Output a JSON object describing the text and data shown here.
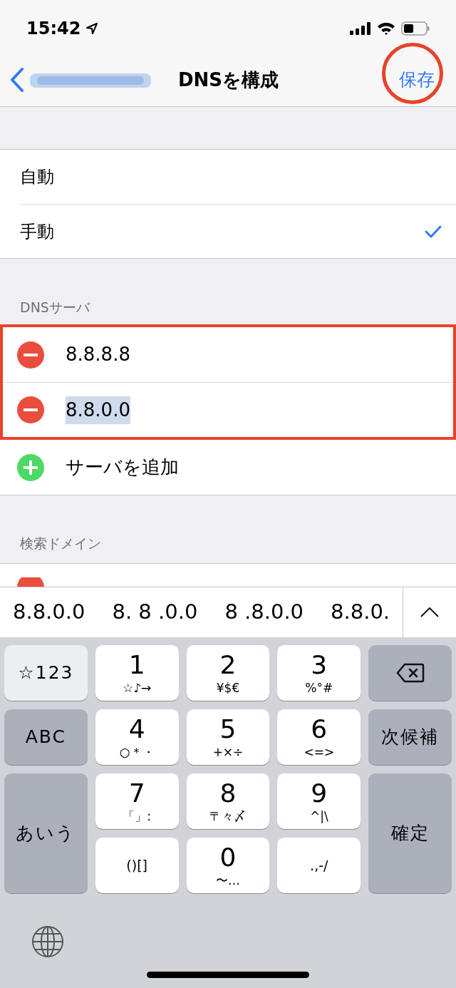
{
  "status_bar": {
    "time": "15:42"
  },
  "nav": {
    "title": "DNSを構成",
    "save": "保存"
  },
  "mode_options": [
    {
      "label": "自動",
      "selected": false
    },
    {
      "label": "手動",
      "selected": true
    }
  ],
  "dns_servers": {
    "header": "DNSサーバ",
    "servers": [
      {
        "value": "8.8.8.8",
        "selected": false
      },
      {
        "value": "8.8.0.0",
        "selected": true
      }
    ],
    "add_label": "サーバを追加"
  },
  "search_domains": {
    "header": "検索ドメイン"
  },
  "candidates": [
    "8.8.0.0",
    "8. 8 .0.0",
    "8 .8.0.0",
    "8.8.0."
  ],
  "keyboard": {
    "keys": [
      {
        "kind": "light",
        "main": "☆123"
      },
      {
        "kind": "digit",
        "main": "1",
        "sub": "☆♪→"
      },
      {
        "kind": "digit",
        "main": "2",
        "sub": "¥$€"
      },
      {
        "kind": "digit",
        "main": "3",
        "sub": "%°#"
      },
      {
        "kind": "delete"
      },
      {
        "kind": "function",
        "main": "ABC"
      },
      {
        "kind": "digit",
        "main": "4",
        "sub": "○＊・"
      },
      {
        "kind": "digit",
        "main": "5",
        "sub": "+×÷"
      },
      {
        "kind": "digit",
        "main": "6",
        "sub": "<=>"
      },
      {
        "kind": "function",
        "main": "次候補"
      },
      {
        "kind": "function",
        "main": "あいう",
        "tall": true
      },
      {
        "kind": "digit",
        "main": "7",
        "sub": "「」:"
      },
      {
        "kind": "digit",
        "main": "8",
        "sub": "〒々〆"
      },
      {
        "kind": "digit",
        "main": "9",
        "sub": "^|\\"
      },
      {
        "kind": "function",
        "main": "確定",
        "tall": true
      },
      {
        "kind": "digit",
        "sub": "()[]"
      },
      {
        "kind": "digit",
        "main": "0",
        "sub": "〜…"
      },
      {
        "kind": "digit",
        "sub": ".,-/"
      }
    ]
  }
}
